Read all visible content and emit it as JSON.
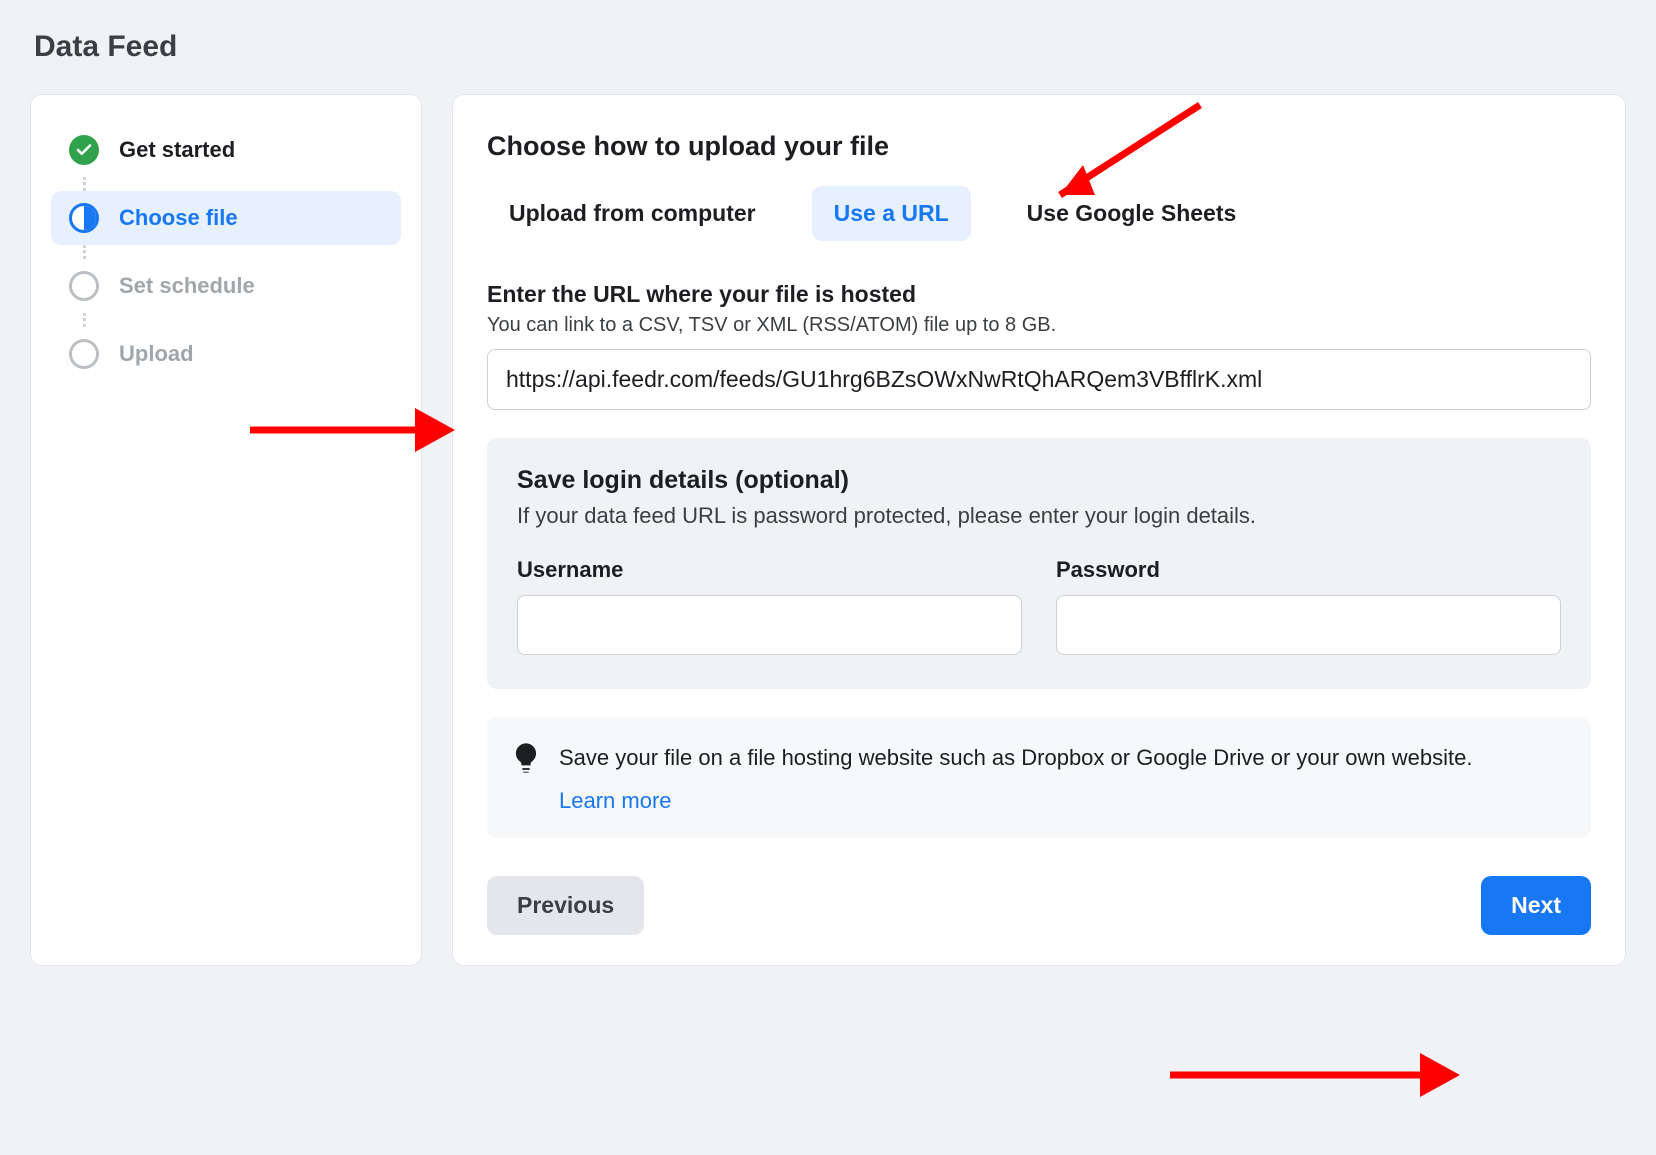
{
  "page": {
    "title": "Data Feed"
  },
  "sidebar": {
    "steps": [
      {
        "label": "Get started",
        "state": "done"
      },
      {
        "label": "Choose file",
        "state": "current"
      },
      {
        "label": "Set schedule",
        "state": "upcoming"
      },
      {
        "label": "Upload",
        "state": "upcoming"
      }
    ]
  },
  "main": {
    "section_title": "Choose how to upload your file",
    "tabs": [
      {
        "label": "Upload from computer",
        "active": false
      },
      {
        "label": "Use a URL",
        "active": true
      },
      {
        "label": "Use Google Sheets",
        "active": false
      }
    ],
    "url_section": {
      "label": "Enter the URL where your file is hosted",
      "hint": "You can link to a CSV, TSV or XML (RSS/ATOM) file up to 8 GB.",
      "value": "https://api.feedr.com/feeds/GU1hrg6BZsOWxNwRtQhARQem3VBfflrK.xml"
    },
    "login_section": {
      "title": "Save login details (optional)",
      "description": "If your data feed URL is password protected, please enter your login details.",
      "username_label": "Username",
      "password_label": "Password",
      "username_value": "",
      "password_value": ""
    },
    "tip": {
      "text": "Save your file on a file hosting website such as Dropbox or Google Drive or your own website.",
      "learn_more": "Learn more"
    },
    "nav": {
      "previous": "Previous",
      "next": "Next"
    }
  }
}
